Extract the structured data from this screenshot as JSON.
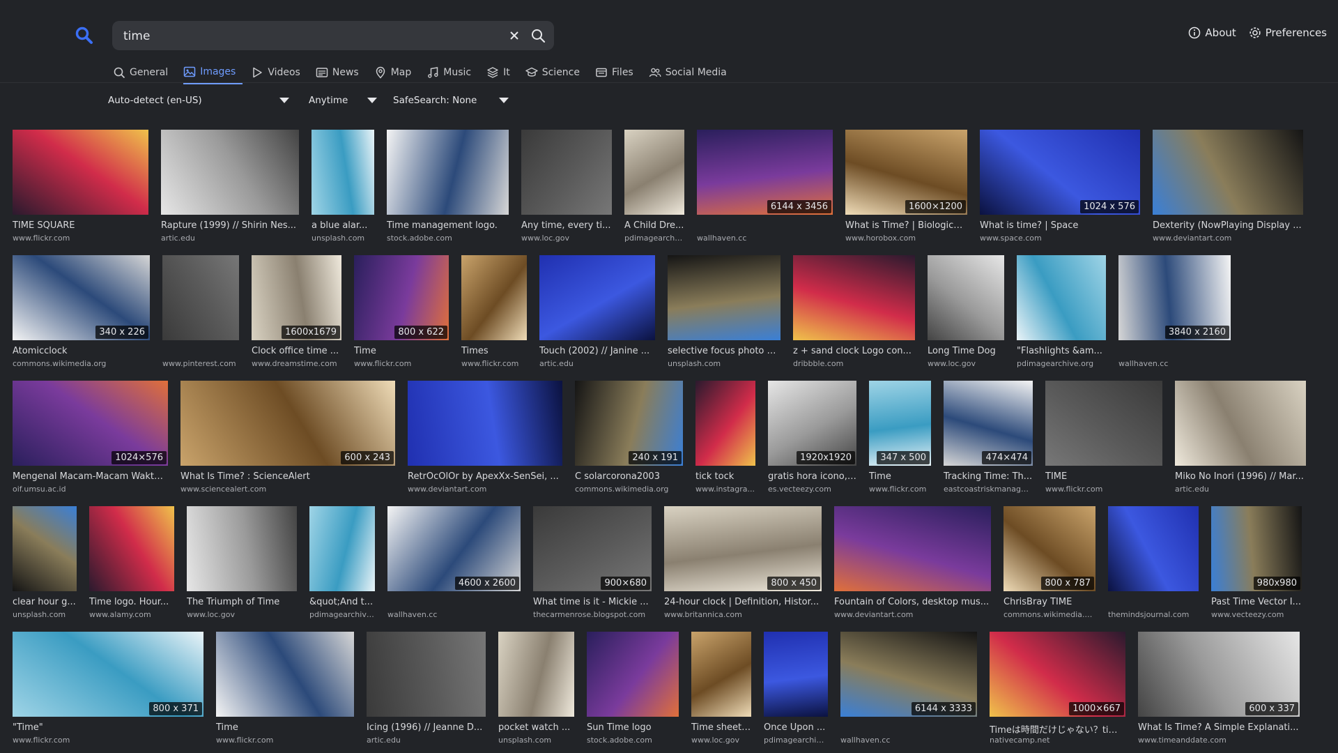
{
  "search": {
    "query": "time"
  },
  "header_links": {
    "about": "About",
    "preferences": "Preferences"
  },
  "tabs": [
    {
      "label": "General",
      "icon": "search-icon"
    },
    {
      "label": "Images",
      "icon": "image-icon",
      "active": true
    },
    {
      "label": "Videos",
      "icon": "play-icon"
    },
    {
      "label": "News",
      "icon": "newspaper-icon"
    },
    {
      "label": "Map",
      "icon": "map-pin-icon"
    },
    {
      "label": "Music",
      "icon": "music-icon"
    },
    {
      "label": "It",
      "icon": "layers-icon"
    },
    {
      "label": "Science",
      "icon": "science-icon"
    },
    {
      "label": "Files",
      "icon": "files-icon"
    },
    {
      "label": "Social Media",
      "icon": "users-icon"
    }
  ],
  "filters": {
    "language": "Auto-detect (en-US)",
    "time": "Anytime",
    "safesearch": "SafeSearch: None"
  },
  "colors": {
    "accent": "#6f9cff",
    "background": "#222428",
    "search_bg": "#35373c"
  },
  "results": [
    [
      {
        "title": "TIME SQUARE",
        "source": "www.flickr.com",
        "dim": ""
      },
      {
        "title": "Rapture (1999) // Shirin Nes...",
        "source": "artic.edu",
        "dim": ""
      },
      {
        "title": "a blue alar...",
        "source": "unsplash.com",
        "dim": ""
      },
      {
        "title": "Time management logo.",
        "source": "stock.adobe.com",
        "dim": ""
      },
      {
        "title": "Any time, every ti...",
        "source": "www.loc.gov",
        "dim": ""
      },
      {
        "title": "A Child Dre...",
        "source": "pdimagearchiv...",
        "dim": ""
      },
      {
        "title": "",
        "source": "wallhaven.cc",
        "dim": "6144 x 3456"
      },
      {
        "title": "What is Time? | Biologica...",
        "source": "www.horobox.com",
        "dim": "1600×1200"
      },
      {
        "title": "What is time? | Space",
        "source": "www.space.com",
        "dim": "1024 x 576"
      },
      {
        "title": "Dexterity (NowPlaying Display ...",
        "source": "www.deviantart.com",
        "dim": ""
      }
    ],
    [
      {
        "title": "Atomicclock",
        "source": "commons.wikimedia.org",
        "dim": "340 x 226"
      },
      {
        "title": "",
        "source": "www.pinterest.com",
        "dim": ""
      },
      {
        "title": "Clock office time ...",
        "source": "www.dreamstime.com",
        "dim": "1600x1679"
      },
      {
        "title": "Time",
        "source": "www.flickr.com",
        "dim": "800 x 622"
      },
      {
        "title": "Times",
        "source": "www.flickr.com",
        "dim": ""
      },
      {
        "title": "Touch (2002) // Janine ...",
        "source": "artic.edu",
        "dim": ""
      },
      {
        "title": "selective focus photo of bro...",
        "source": "unsplash.com",
        "dim": ""
      },
      {
        "title": "z + sand clock Logo con...",
        "source": "dribbble.com",
        "dim": ""
      },
      {
        "title": "Long Time Dog",
        "source": "www.loc.gov",
        "dim": ""
      },
      {
        "title": "\"Flashlights &am...",
        "source": "pdimagearchive.org",
        "dim": ""
      },
      {
        "title": "",
        "source": "wallhaven.cc",
        "dim": "3840 x 2160"
      }
    ],
    [
      {
        "title": "Mengenal Macam-Macam Waktu...",
        "source": "oif.umsu.ac.id",
        "dim": "1024×576"
      },
      {
        "title": "What Is Time? : ScienceAlert",
        "source": "www.sciencealert.com",
        "dim": "600 x 243"
      },
      {
        "title": "RetrOcOlOr by ApexXx-SenSei, ...",
        "source": "www.deviantart.com",
        "dim": ""
      },
      {
        "title": "C solarcorona2003",
        "source": "commons.wikimedia.org",
        "dim": "240 x 191"
      },
      {
        "title": "tick tock",
        "source": "www.instagra...",
        "dim": ""
      },
      {
        "title": "gratis hora icono, ...",
        "source": "es.vecteezy.com",
        "dim": "1920x1920"
      },
      {
        "title": "Time",
        "source": "www.flickr.com",
        "dim": "347 x 500"
      },
      {
        "title": "Tracking Time: Th...",
        "source": "eastcoastriskmanagem...",
        "dim": "474×474"
      },
      {
        "title": "TIME",
        "source": "www.flickr.com",
        "dim": ""
      },
      {
        "title": "Miko No Inori (1996) // Mar...",
        "source": "artic.edu",
        "dim": ""
      }
    ],
    [
      {
        "title": "clear hour g...",
        "source": "unsplash.com",
        "dim": ""
      },
      {
        "title": "Time logo. Hour...",
        "source": "www.alamy.com",
        "dim": ""
      },
      {
        "title": "The Triumph of Time",
        "source": "www.loc.gov",
        "dim": ""
      },
      {
        "title": "&quot;And t...",
        "source": "pdimagearchive...",
        "dim": ""
      },
      {
        "title": "",
        "source": "wallhaven.cc",
        "dim": "4600 x 2600"
      },
      {
        "title": "What time is it - Mickie ...",
        "source": "thecarmenrose.blogspot.com",
        "dim": "900×680"
      },
      {
        "title": "24-hour clock | Definition, Histor...",
        "source": "www.britannica.com",
        "dim": "800 x 450"
      },
      {
        "title": "Fountain of Colors, desktop mus...",
        "source": "www.deviantart.com",
        "dim": ""
      },
      {
        "title": "ChrisBray TIME",
        "source": "commons.wikimedia.org",
        "dim": "800 x 787"
      },
      {
        "title": "",
        "source": "themindsjournal.com",
        "dim": ""
      },
      {
        "title": "Past Time Vector I...",
        "source": "www.vecteezy.com",
        "dim": "980x980"
      }
    ],
    [
      {
        "title": "\"Time\"",
        "source": "www.flickr.com",
        "dim": "800 x 371"
      },
      {
        "title": "Time",
        "source": "www.flickr.com",
        "dim": ""
      },
      {
        "title": "Icing (1996) // Jeanne D...",
        "source": "artic.edu",
        "dim": ""
      },
      {
        "title": "pocket watch ...",
        "source": "unsplash.com",
        "dim": ""
      },
      {
        "title": "Sun Time logo",
        "source": "stock.adobe.com",
        "dim": ""
      },
      {
        "title": "Time sheet fo...",
        "source": "www.loc.gov",
        "dim": ""
      },
      {
        "title": "Once Upon ...",
        "source": "pdimagearchive...",
        "dim": ""
      },
      {
        "title": "",
        "source": "wallhaven.cc",
        "dim": "6144 x 3333"
      },
      {
        "title": "Timeは時間だけじゃない？tim...",
        "source": "nativecamp.net",
        "dim": "1000×667"
      },
      {
        "title": "What Is Time? A Simple Explanati...",
        "source": "www.timeanddate.com",
        "dim": "600 x 337"
      }
    ]
  ]
}
